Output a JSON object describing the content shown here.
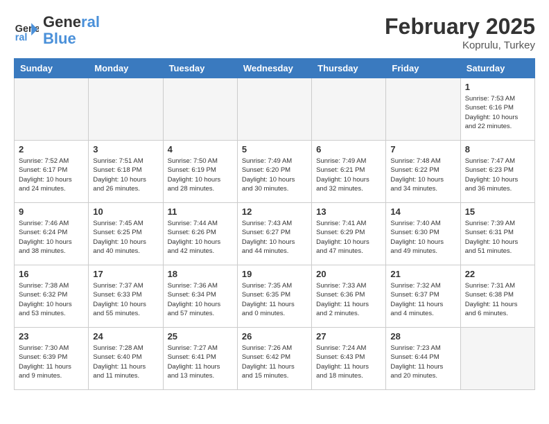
{
  "header": {
    "logo_general": "General",
    "logo_blue": "Blue",
    "title": "February 2025",
    "subtitle": "Koprulu, Turkey"
  },
  "weekdays": [
    "Sunday",
    "Monday",
    "Tuesday",
    "Wednesday",
    "Thursday",
    "Friday",
    "Saturday"
  ],
  "weeks": [
    [
      {
        "day": null
      },
      {
        "day": null
      },
      {
        "day": null
      },
      {
        "day": null
      },
      {
        "day": null
      },
      {
        "day": null
      },
      {
        "day": "1",
        "sunrise": "7:53 AM",
        "sunset": "6:16 PM",
        "daylight": "10 hours and 22 minutes."
      }
    ],
    [
      {
        "day": "2",
        "sunrise": "7:52 AM",
        "sunset": "6:17 PM",
        "daylight": "10 hours and 24 minutes."
      },
      {
        "day": "3",
        "sunrise": "7:51 AM",
        "sunset": "6:18 PM",
        "daylight": "10 hours and 26 minutes."
      },
      {
        "day": "4",
        "sunrise": "7:50 AM",
        "sunset": "6:19 PM",
        "daylight": "10 hours and 28 minutes."
      },
      {
        "day": "5",
        "sunrise": "7:49 AM",
        "sunset": "6:20 PM",
        "daylight": "10 hours and 30 minutes."
      },
      {
        "day": "6",
        "sunrise": "7:49 AM",
        "sunset": "6:21 PM",
        "daylight": "10 hours and 32 minutes."
      },
      {
        "day": "7",
        "sunrise": "7:48 AM",
        "sunset": "6:22 PM",
        "daylight": "10 hours and 34 minutes."
      },
      {
        "day": "8",
        "sunrise": "7:47 AM",
        "sunset": "6:23 PM",
        "daylight": "10 hours and 36 minutes."
      }
    ],
    [
      {
        "day": "9",
        "sunrise": "7:46 AM",
        "sunset": "6:24 PM",
        "daylight": "10 hours and 38 minutes."
      },
      {
        "day": "10",
        "sunrise": "7:45 AM",
        "sunset": "6:25 PM",
        "daylight": "10 hours and 40 minutes."
      },
      {
        "day": "11",
        "sunrise": "7:44 AM",
        "sunset": "6:26 PM",
        "daylight": "10 hours and 42 minutes."
      },
      {
        "day": "12",
        "sunrise": "7:43 AM",
        "sunset": "6:27 PM",
        "daylight": "10 hours and 44 minutes."
      },
      {
        "day": "13",
        "sunrise": "7:41 AM",
        "sunset": "6:29 PM",
        "daylight": "10 hours and 47 minutes."
      },
      {
        "day": "14",
        "sunrise": "7:40 AM",
        "sunset": "6:30 PM",
        "daylight": "10 hours and 49 minutes."
      },
      {
        "day": "15",
        "sunrise": "7:39 AM",
        "sunset": "6:31 PM",
        "daylight": "10 hours and 51 minutes."
      }
    ],
    [
      {
        "day": "16",
        "sunrise": "7:38 AM",
        "sunset": "6:32 PM",
        "daylight": "10 hours and 53 minutes."
      },
      {
        "day": "17",
        "sunrise": "7:37 AM",
        "sunset": "6:33 PM",
        "daylight": "10 hours and 55 minutes."
      },
      {
        "day": "18",
        "sunrise": "7:36 AM",
        "sunset": "6:34 PM",
        "daylight": "10 hours and 57 minutes."
      },
      {
        "day": "19",
        "sunrise": "7:35 AM",
        "sunset": "6:35 PM",
        "daylight": "11 hours and 0 minutes."
      },
      {
        "day": "20",
        "sunrise": "7:33 AM",
        "sunset": "6:36 PM",
        "daylight": "11 hours and 2 minutes."
      },
      {
        "day": "21",
        "sunrise": "7:32 AM",
        "sunset": "6:37 PM",
        "daylight": "11 hours and 4 minutes."
      },
      {
        "day": "22",
        "sunrise": "7:31 AM",
        "sunset": "6:38 PM",
        "daylight": "11 hours and 6 minutes."
      }
    ],
    [
      {
        "day": "23",
        "sunrise": "7:30 AM",
        "sunset": "6:39 PM",
        "daylight": "11 hours and 9 minutes."
      },
      {
        "day": "24",
        "sunrise": "7:28 AM",
        "sunset": "6:40 PM",
        "daylight": "11 hours and 11 minutes."
      },
      {
        "day": "25",
        "sunrise": "7:27 AM",
        "sunset": "6:41 PM",
        "daylight": "11 hours and 13 minutes."
      },
      {
        "day": "26",
        "sunrise": "7:26 AM",
        "sunset": "6:42 PM",
        "daylight": "11 hours and 15 minutes."
      },
      {
        "day": "27",
        "sunrise": "7:24 AM",
        "sunset": "6:43 PM",
        "daylight": "11 hours and 18 minutes."
      },
      {
        "day": "28",
        "sunrise": "7:23 AM",
        "sunset": "6:44 PM",
        "daylight": "11 hours and 20 minutes."
      },
      {
        "day": null
      }
    ]
  ]
}
